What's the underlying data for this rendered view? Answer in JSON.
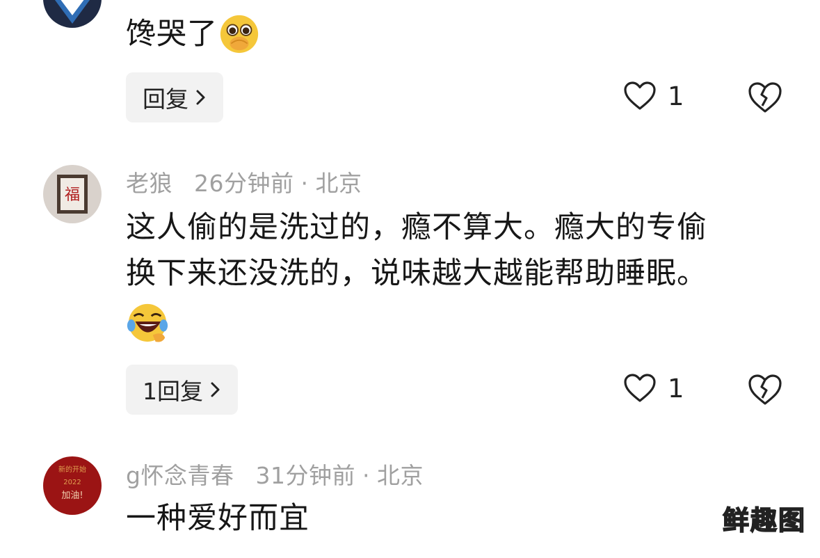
{
  "comments": [
    {
      "text": "馋哭了",
      "reply_label": "回复",
      "likes": "1"
    },
    {
      "user": "老狼",
      "time": "26分钟前",
      "location": "北京",
      "text_line1": "这人偷的是洗过的，瘾不算大。瘾大的专偷",
      "text_line2": "换下来还没洗的，说味越大越能帮助睡眠。",
      "reply_label": "1回复",
      "likes": "1"
    },
    {
      "user": "g怀念青春",
      "time": "31分钟前",
      "location": "北京",
      "text": "一种爱好而宜",
      "avatar_text_top": "新的开始",
      "avatar_text_mid": "2022",
      "avatar_text_bottom": "加油!"
    }
  ],
  "watermark": "鲜趣图",
  "colors": {
    "reply_bg": "#f2f2f2",
    "meta": "#a0a0a0",
    "avatar3_bg": "#9b1414"
  },
  "icons": [
    "heart-icon",
    "broken-heart-icon",
    "chevron-right-icon",
    "pleading-emoji",
    "laughing-crying-emoji"
  ]
}
